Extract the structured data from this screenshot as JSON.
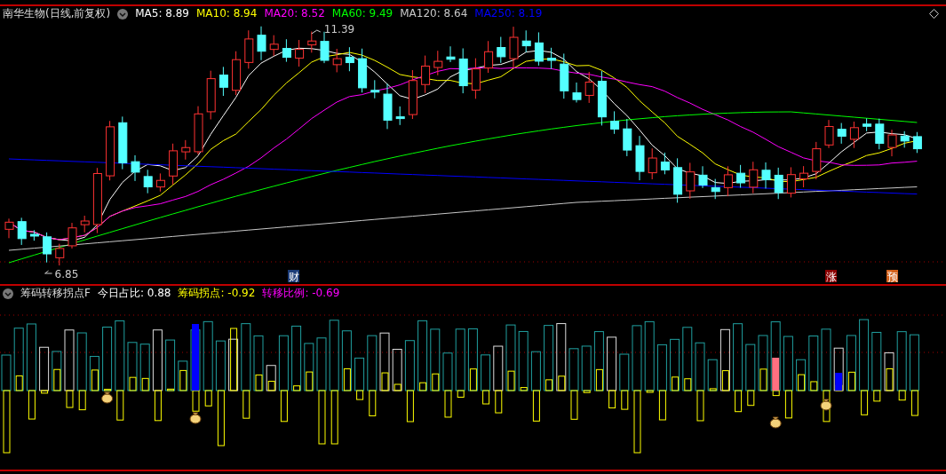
{
  "title": "南华生物(日线,前复权)",
  "ma_legend": [
    {
      "label": "MA5: 8.89",
      "color": "#ffffff"
    },
    {
      "label": "MA10: 8.94",
      "color": "#ffff00"
    },
    {
      "label": "MA20: 8.52",
      "color": "#ff00ff"
    },
    {
      "label": "MA60: 9.49",
      "color": "#00ff00"
    },
    {
      "label": "MA120: 8.64",
      "color": "#c8c8c8"
    },
    {
      "label": "MA250: 8.19",
      "color": "#0000ff"
    }
  ],
  "price_marks": {
    "high": "11.39",
    "low": "6.85"
  },
  "event_tags": [
    {
      "text": "财",
      "color": "#1c3c78"
    },
    {
      "text": "涨",
      "color": "#8b0000"
    },
    {
      "text": "预",
      "color": "#d2601a"
    }
  ],
  "indicator": {
    "name": "筹码转移拐点F",
    "values": [
      {
        "label": "今日占比: 0.88",
        "color": "#ffffff"
      },
      {
        "label": "筹码拐点: -0.92",
        "color": "#ffff00"
      },
      {
        "label": "转移比例: -0.69",
        "color": "#ff00ff"
      }
    ]
  }
}
